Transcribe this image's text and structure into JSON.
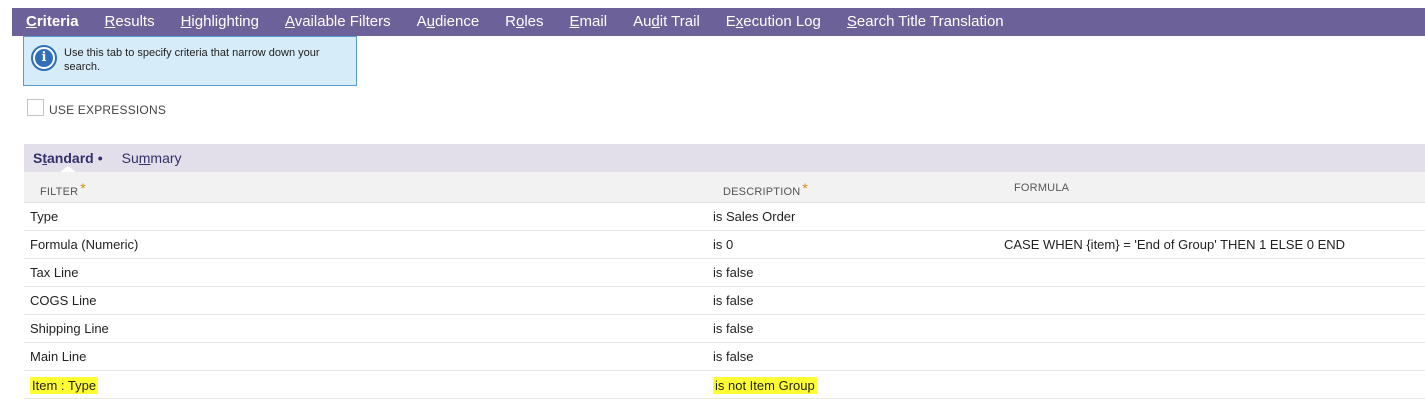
{
  "tabs": [
    {
      "pre": "",
      "u": "C",
      "post": "riteria",
      "active": true
    },
    {
      "pre": "",
      "u": "R",
      "post": "esults",
      "active": false
    },
    {
      "pre": "",
      "u": "H",
      "post": "ighlighting",
      "active": false
    },
    {
      "pre": "",
      "u": "A",
      "post": "vailable Filters",
      "active": false
    },
    {
      "pre": "A",
      "u": "u",
      "post": "dience",
      "active": false
    },
    {
      "pre": "R",
      "u": "o",
      "post": "les",
      "active": false
    },
    {
      "pre": "",
      "u": "E",
      "post": "mail",
      "active": false
    },
    {
      "pre": "Au",
      "u": "d",
      "post": "it Trail",
      "active": false
    },
    {
      "pre": "E",
      "u": "x",
      "post": "ecution Log",
      "active": false
    },
    {
      "pre": "",
      "u": "S",
      "post": "earch Title Translation",
      "active": false
    }
  ],
  "info": {
    "icon": "info-icon",
    "text": "Use this tab to specify criteria that narrow down your search."
  },
  "use_expressions": {
    "label": "USE EXPRESSIONS",
    "checked": false
  },
  "subtabs": {
    "standard": {
      "pre": "S",
      "u": "t",
      "post": "andard",
      "dot": "•"
    },
    "summary": {
      "pre": "Su",
      "u": "m",
      "post": "mary"
    }
  },
  "grid": {
    "headers": {
      "filter": "FILTER",
      "description": "DESCRIPTION",
      "formula": "FORMULA",
      "required_mark": "*"
    },
    "rows": [
      {
        "filter": "Type",
        "description": "is Sales Order",
        "formula": "",
        "highlight": false
      },
      {
        "filter": "Formula (Numeric)",
        "description": "is 0",
        "formula": "CASE WHEN {item} = 'End of Group' THEN 1 ELSE 0 END",
        "highlight": false
      },
      {
        "filter": "Tax Line",
        "description": "is false",
        "formula": "",
        "highlight": false
      },
      {
        "filter": "COGS Line",
        "description": "is false",
        "formula": "",
        "highlight": false
      },
      {
        "filter": "Shipping Line",
        "description": "is false",
        "formula": "",
        "highlight": false
      },
      {
        "filter": "Main Line",
        "description": "is false",
        "formula": "",
        "highlight": false
      },
      {
        "filter": "Item : Type",
        "description": "is not Item Group",
        "formula": "",
        "highlight": true
      }
    ]
  },
  "colors": {
    "tabbar_bg": "#6d6199",
    "info_bg": "#d6ecf8",
    "highlight": "#ffff33",
    "required": "#d98e04"
  }
}
